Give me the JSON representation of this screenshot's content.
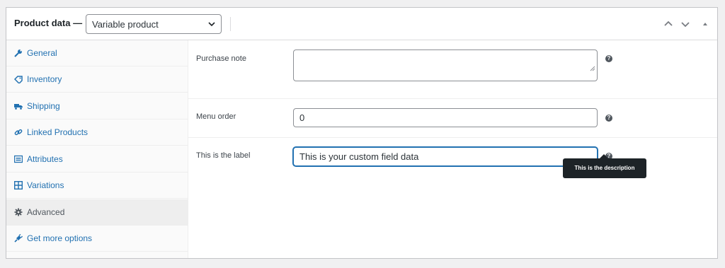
{
  "header": {
    "title": "Product data —",
    "product_type": "Variable product"
  },
  "tabs": [
    {
      "label": "General",
      "icon": "wrench-icon"
    },
    {
      "label": "Inventory",
      "icon": "tag-icon"
    },
    {
      "label": "Shipping",
      "icon": "truck-icon"
    },
    {
      "label": "Linked Products",
      "icon": "link-icon"
    },
    {
      "label": "Attributes",
      "icon": "list-icon"
    },
    {
      "label": "Variations",
      "icon": "grid-icon"
    },
    {
      "label": "Advanced",
      "icon": "gear-icon",
      "active": true
    },
    {
      "label": "Get more options",
      "icon": "plugin-icon"
    }
  ],
  "fields": {
    "purchase_note": {
      "label": "Purchase note",
      "value": ""
    },
    "menu_order": {
      "label": "Menu order",
      "value": "0"
    },
    "custom": {
      "label": "This is the label",
      "value": "This is your custom field data"
    }
  },
  "help_icon": "?",
  "tooltip": "This is the description",
  "colors": {
    "accent": "#2271b1",
    "tooltip_bg": "#1d2327"
  }
}
